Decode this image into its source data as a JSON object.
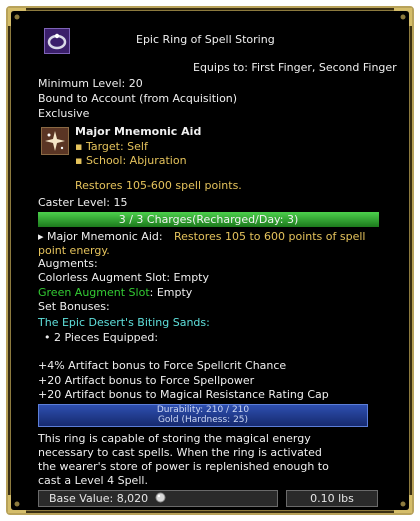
{
  "item": {
    "title": "Epic Ring of Spell Storing",
    "equips_to": "Equips to: First Finger, Second Finger",
    "min_level": "Minimum Level: 20",
    "bound": "Bound to Account (from Acquisition)",
    "exclusive": "Exclusive"
  },
  "spell": {
    "name": "Major Mnemonic Aid",
    "target": "▪ Target: Self",
    "school": "▪ School: Abjuration",
    "restores": "Restores 105-600 spell points.",
    "caster_level": "Caster Level: 15"
  },
  "charges": {
    "text": "3 / 3 Charges(Recharged/Day: 3)",
    "fraction": 1.0
  },
  "effect": {
    "name": "▸ Major Mnemonic Aid:",
    "desc_line1": "Restores 105 to 600 points of spell",
    "desc_line2": "point energy."
  },
  "augments": {
    "header": "Augments:",
    "colorless_slot": "Colorless Augment Slot: Empty",
    "green_label": "Green Augment Slot",
    "green_value": ": Empty"
  },
  "set_bonuses": {
    "header": "Set Bonuses:",
    "set_name": "The Epic Desert's Biting Sands:",
    "pieces": "• 2 Pieces Equipped:",
    "bonus1": "+4% Artifact bonus to Force Spellcrit Chance",
    "bonus2": "+20 Artifact bonus to Force Spellpower",
    "bonus3": "+20 Artifact bonus to Magical Resistance Rating Cap"
  },
  "durability": {
    "line1": "Durability: 210 / 210",
    "line2": "Gold (Hardness: 25)",
    "fraction": 1.0
  },
  "description": {
    "line1": "This ring is capable of storing the magical energy",
    "line2": "necessary to cast spells. When the ring is activated",
    "line3": "the wearer's store of power is replenished enough to",
    "line4": "cast a Level 4 Spell."
  },
  "footer": {
    "base_value": "Base Value: 8,020",
    "weight": "0.10 lbs"
  },
  "icons": {
    "item_icon": "ring-icon",
    "spell_icon": "sparkle-icon",
    "coin_icon": "platinum-coin-icon"
  },
  "colors": {
    "gold_text": "#e5c35c",
    "green_text": "#33cc33",
    "cyan_text": "#5fe0dc",
    "charges_bar": "#2fa52f",
    "durability_bar": "#2244a0"
  }
}
